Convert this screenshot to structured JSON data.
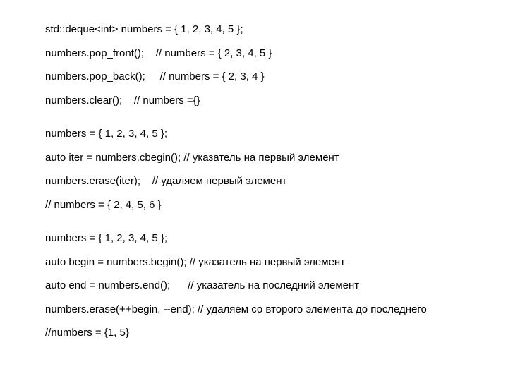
{
  "lines": [
    "std::deque<int> numbers = { 1, 2, 3, 4, 5 };",
    "numbers.pop_front();    // numbers = { 2, 3, 4, 5 }",
    "numbers.pop_back();     // numbers = { 2, 3, 4 }",
    "numbers.clear();    // numbers ={}",
    "",
    "numbers = { 1, 2, 3, 4, 5 };",
    "auto iter = numbers.cbegin(); // указатель на первый элемент",
    "numbers.erase(iter);    // удаляем первый элемент",
    "// numbers = { 2, 4, 5, 6 }",
    "",
    "numbers = { 1, 2, 3, 4, 5 };",
    "auto begin = numbers.begin(); // указатель на первый элемент",
    "auto end = numbers.end();      // указатель на последний элемент",
    "numbers.erase(++begin, --end);  // удаляем со второго элемента до последнего",
    "//numbers = {1, 5}"
  ]
}
